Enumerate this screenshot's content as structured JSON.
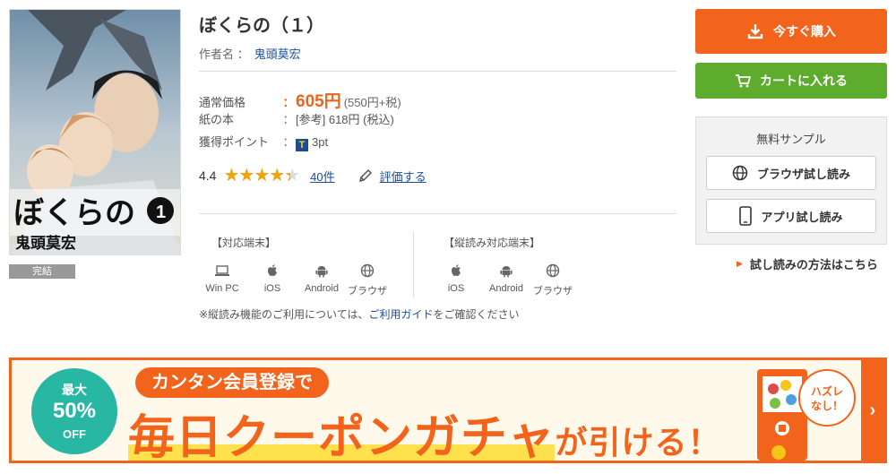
{
  "book": {
    "title": "ぼくらの（１）",
    "cover_title": "ぼくらの",
    "cover_volume": "1",
    "cover_author": "鬼頭莫宏",
    "status_tag": "完結",
    "author_label": "作者名 ：",
    "author": "鬼頭莫宏"
  },
  "pricing": {
    "regular_label": "通常価格",
    "regular_sep": "：",
    "regular_price": "605円",
    "regular_sub": "(550円+税)",
    "paper_label": "紙の本",
    "paper_sep": "：",
    "paper_value": "[参考] 618円 (税込)",
    "points_label": "獲得ポイント",
    "points_sep": "：",
    "points_badge": "T",
    "points_value": "3pt"
  },
  "rating": {
    "score": "4.4",
    "stars_text": "★★★★★",
    "fill_fraction": 0.88,
    "count": "40件",
    "review_label": "評価する"
  },
  "devices": {
    "supported_heading": "【対応端末】",
    "supported": [
      {
        "label": "Win PC",
        "icon": "laptop-icon"
      },
      {
        "label": "iOS",
        "icon": "apple-icon"
      },
      {
        "label": "Android",
        "icon": "android-icon"
      },
      {
        "label": "ブラウザ",
        "icon": "globe-icon"
      }
    ],
    "vertical_heading": "【縦読み対応端末】",
    "vertical": [
      {
        "label": "iOS",
        "icon": "apple-icon"
      },
      {
        "label": "Android",
        "icon": "android-icon"
      },
      {
        "label": "ブラウザ",
        "icon": "globe-icon"
      }
    ],
    "note_prefix": "※縦読み機能のご利用については、",
    "note_link": "ご利用ガイド",
    "note_suffix": "をご確認ください"
  },
  "actions": {
    "buy_label": "今すぐ購入",
    "cart_label": "カートに入れる",
    "sample_title": "無料サンプル",
    "browser_sample": "ブラウザ試し読み",
    "app_sample": "アプリ試し読み",
    "howto_link": "試し読みの方法はこちら"
  },
  "banner": {
    "badge_top": "最大",
    "badge_pct": "50%",
    "badge_bottom": "OFF",
    "pill_text": "カンタン会員登録で",
    "headline_main": "毎日クーポンガチャ",
    "headline_small": "が引ける！",
    "bubble_line1": "ハズレ",
    "bubble_line2": "なし！",
    "arrow": "›"
  },
  "colors": {
    "accent": "#f2631c",
    "cart_green": "#5eac2d",
    "link_blue": "#1a4c9b",
    "star": "#f0a30a",
    "badge_teal": "#27b7a3"
  }
}
